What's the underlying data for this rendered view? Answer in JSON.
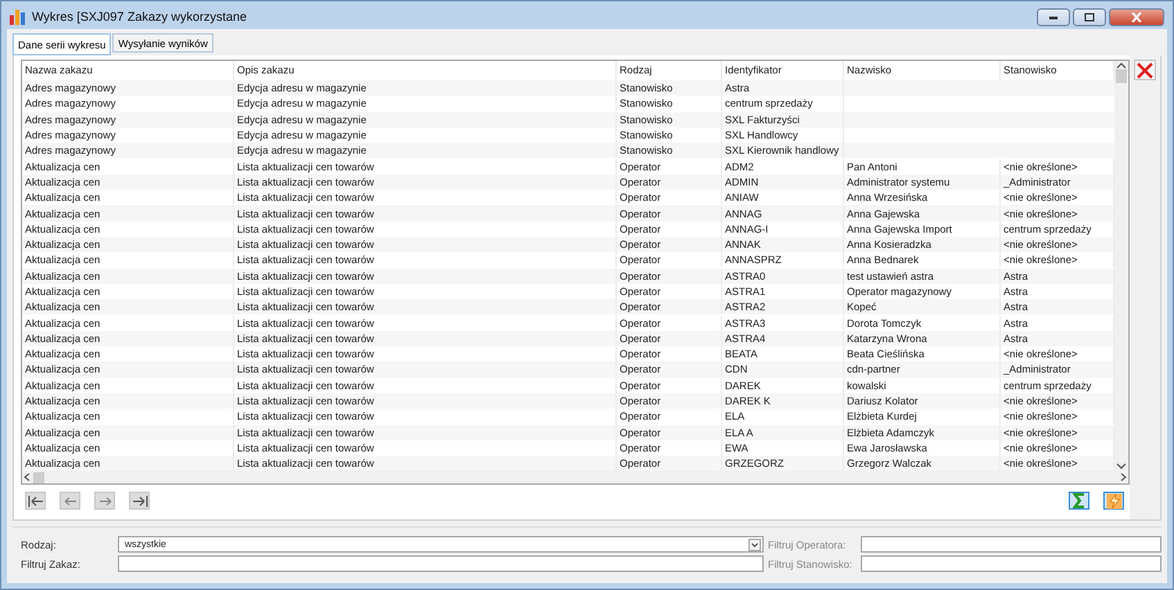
{
  "window": {
    "title": "Wykres [SXJ097 Zakazy wykorzystane"
  },
  "tabs": [
    {
      "label": "Dane serii wykresu",
      "selected": true
    },
    {
      "label": "Wysyłanie wyników",
      "selected": false
    }
  ],
  "table": {
    "columns": [
      "Nazwa zakazu",
      "Opis zakazu",
      "Rodzaj",
      "Identyfikator",
      "Nazwisko",
      "Stanowisko"
    ],
    "rows": [
      [
        "Adres magazynowy",
        "Edycja adresu w magazynie",
        "Stanowisko",
        "Astra",
        "",
        ""
      ],
      [
        "Adres magazynowy",
        "Edycja adresu w magazynie",
        "Stanowisko",
        "centrum sprzedaży",
        "",
        ""
      ],
      [
        "Adres magazynowy",
        "Edycja adresu w magazynie",
        "Stanowisko",
        "SXL Fakturzyści",
        "",
        ""
      ],
      [
        "Adres magazynowy",
        "Edycja adresu w magazynie",
        "Stanowisko",
        "SXL Handlowcy",
        "",
        ""
      ],
      [
        "Adres magazynowy",
        "Edycja adresu w magazynie",
        "Stanowisko",
        "SXL Kierownik handlowy",
        "",
        ""
      ],
      [
        "Aktualizacja cen",
        "Lista aktualizacji cen towarów",
        "Operator",
        "ADM2",
        "Pan Antoni",
        "<nie określone>"
      ],
      [
        "Aktualizacja cen",
        "Lista aktualizacji cen towarów",
        "Operator",
        "ADMIN",
        "Administrator systemu",
        "_Administrator"
      ],
      [
        "Aktualizacja cen",
        "Lista aktualizacji cen towarów",
        "Operator",
        "ANIAW",
        "Anna Wrzesińska",
        "<nie określone>"
      ],
      [
        "Aktualizacja cen",
        "Lista aktualizacji cen towarów",
        "Operator",
        "ANNAG",
        "Anna Gajewska",
        "<nie określone>"
      ],
      [
        "Aktualizacja cen",
        "Lista aktualizacji cen towarów",
        "Operator",
        "ANNAG-I",
        "Anna  Gajewska Import",
        "centrum sprzedaży"
      ],
      [
        "Aktualizacja cen",
        "Lista aktualizacji cen towarów",
        "Operator",
        "ANNAK",
        "Anna Kosieradzka",
        "<nie określone>"
      ],
      [
        "Aktualizacja cen",
        "Lista aktualizacji cen towarów",
        "Operator",
        "ANNASPRZ",
        "Anna Bednarek",
        "<nie określone>"
      ],
      [
        "Aktualizacja cen",
        "Lista aktualizacji cen towarów",
        "Operator",
        "ASTRA0",
        "test ustawień astra",
        "Astra"
      ],
      [
        "Aktualizacja cen",
        "Lista aktualizacji cen towarów",
        "Operator",
        "ASTRA1",
        "Operator magazynowy",
        "Astra"
      ],
      [
        "Aktualizacja cen",
        "Lista aktualizacji cen towarów",
        "Operator",
        "ASTRA2",
        "Kopeć",
        "Astra"
      ],
      [
        "Aktualizacja cen",
        "Lista aktualizacji cen towarów",
        "Operator",
        "ASTRA3",
        "Dorota Tomczyk",
        "Astra"
      ],
      [
        "Aktualizacja cen",
        "Lista aktualizacji cen towarów",
        "Operator",
        "ASTRA4",
        "Katarzyna Wrona",
        "Astra"
      ],
      [
        "Aktualizacja cen",
        "Lista aktualizacji cen towarów",
        "Operator",
        "BEATA",
        "Beata Cieślińska",
        "<nie określone>"
      ],
      [
        "Aktualizacja cen",
        "Lista aktualizacji cen towarów",
        "Operator",
        "CDN",
        "cdn-partner",
        "_Administrator"
      ],
      [
        "Aktualizacja cen",
        "Lista aktualizacji cen towarów",
        "Operator",
        "DAREK",
        "kowalski",
        "centrum sprzedaży"
      ],
      [
        "Aktualizacja cen",
        "Lista aktualizacji cen towarów",
        "Operator",
        "DAREK K",
        "Dariusz Kolator",
        "<nie określone>"
      ],
      [
        "Aktualizacja cen",
        "Lista aktualizacji cen towarów",
        "Operator",
        "ELA",
        "Elżbieta Kurdej",
        "<nie określone>"
      ],
      [
        "Aktualizacja cen",
        "Lista aktualizacji cen towarów",
        "Operator",
        "ELA A",
        "Elżbieta Adamczyk",
        "<nie określone>"
      ],
      [
        "Aktualizacja cen",
        "Lista aktualizacji cen towarów",
        "Operator",
        "EWA",
        "Ewa Jarosławska",
        "<nie określone>"
      ],
      [
        "Aktualizacja cen",
        "Lista aktualizacji cen towarów",
        "Operator",
        "GRZEGORZ",
        "Grzegorz Walczak",
        "<nie określone>"
      ]
    ]
  },
  "filters": {
    "rodzaj_label": "Rodzaj:",
    "rodzaj_value": "wszystkie",
    "zakaz_label": "Filtruj Zakaz:",
    "operator_label": "Filtruj Operatora:",
    "stanowisko_label": "Filtruj Stanowisko:"
  }
}
